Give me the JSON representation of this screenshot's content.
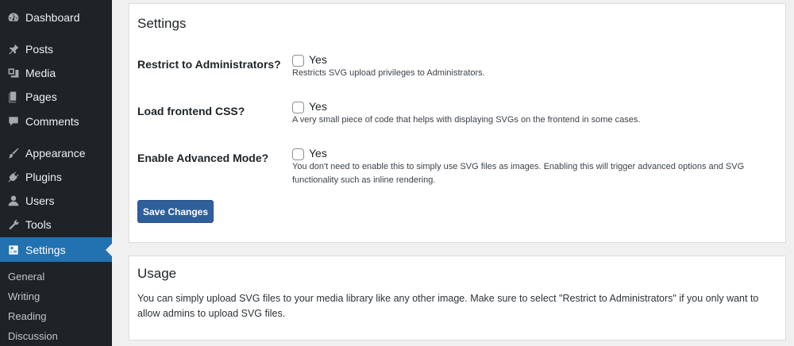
{
  "sidebar": {
    "items": [
      {
        "label": "Dashboard",
        "icon": "dashboard-icon"
      },
      {
        "label": "Posts",
        "icon": "pin-icon"
      },
      {
        "label": "Media",
        "icon": "media-icon"
      },
      {
        "label": "Pages",
        "icon": "pages-icon"
      },
      {
        "label": "Comments",
        "icon": "comment-icon"
      },
      {
        "label": "Appearance",
        "icon": "brush-icon"
      },
      {
        "label": "Plugins",
        "icon": "plugin-icon"
      },
      {
        "label": "Users",
        "icon": "user-icon"
      },
      {
        "label": "Tools",
        "icon": "wrench-icon"
      },
      {
        "label": "Settings",
        "icon": "settings-icon",
        "active": true
      }
    ],
    "submenu": [
      "General",
      "Writing",
      "Reading",
      "Discussion"
    ]
  },
  "settings": {
    "title": "Settings",
    "rows": [
      {
        "label": "Restrict to Administrators?",
        "option": "Yes",
        "checked": false,
        "description": [
          "Restricts SVG upload privileges to Administrators."
        ]
      },
      {
        "label": "Load frontend CSS?",
        "option": "Yes",
        "checked": false,
        "description": [
          "A very small piece of code that helps with displaying SVGs on the frontend in some cases."
        ]
      },
      {
        "label": "Enable Advanced Mode?",
        "option": "Yes",
        "checked": false,
        "description": [
          "You don't need to enable this to simply use SVG files as images. Enabling this will trigger advanced options and SVG",
          "functionality such as inline rendering."
        ]
      }
    ],
    "save_label": "Save Changes"
  },
  "usage": {
    "title": "Usage",
    "text": "You can simply upload SVG files to your media library like any other image. Make sure to select \"Restrict to Administrators\" if you only want to allow admins to upload SVG files."
  },
  "colors": {
    "sidebar_bg": "#1d2327",
    "active_bg": "#2271b1",
    "button_bg": "#2f5f9b",
    "page_bg": "#f0f0f1"
  }
}
